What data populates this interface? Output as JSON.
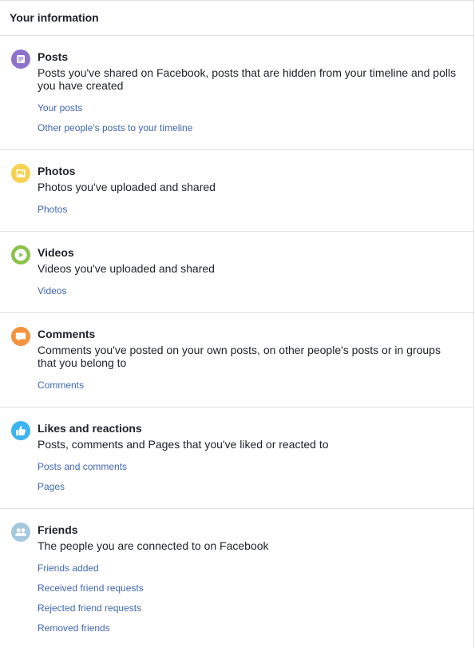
{
  "header": {
    "title": "Your information"
  },
  "colors": {
    "posts": "#8c72cb",
    "photos": "#f7d150",
    "videos": "#8bc34a",
    "comments": "#f5923e",
    "likes": "#3bb4f0",
    "friends": "#a5c8de",
    "link": "#4267b2"
  },
  "sections": [
    {
      "icon": "posts-icon",
      "title": "Posts",
      "description": "Posts you've shared on Facebook, posts that are hidden from your timeline and polls you have created",
      "links": [
        "Your posts",
        "Other people's posts to your timeline"
      ]
    },
    {
      "icon": "photos-icon",
      "title": "Photos",
      "description": "Photos you've uploaded and shared",
      "links": [
        "Photos"
      ]
    },
    {
      "icon": "videos-icon",
      "title": "Videos",
      "description": "Videos you've uploaded and shared",
      "links": [
        "Videos"
      ]
    },
    {
      "icon": "comments-icon",
      "title": "Comments",
      "description": "Comments you've posted on your own posts, on other people's posts or in groups that you belong to",
      "links": [
        "Comments"
      ]
    },
    {
      "icon": "likes-icon",
      "title": "Likes and reactions",
      "description": "Posts, comments and Pages that you've liked or reacted to",
      "links": [
        "Posts and comments",
        "Pages"
      ]
    },
    {
      "icon": "friends-icon",
      "title": "Friends",
      "description": "The people you are connected to on Facebook",
      "links": [
        "Friends added",
        "Received friend requests",
        "Rejected friend requests",
        "Removed friends"
      ]
    }
  ]
}
